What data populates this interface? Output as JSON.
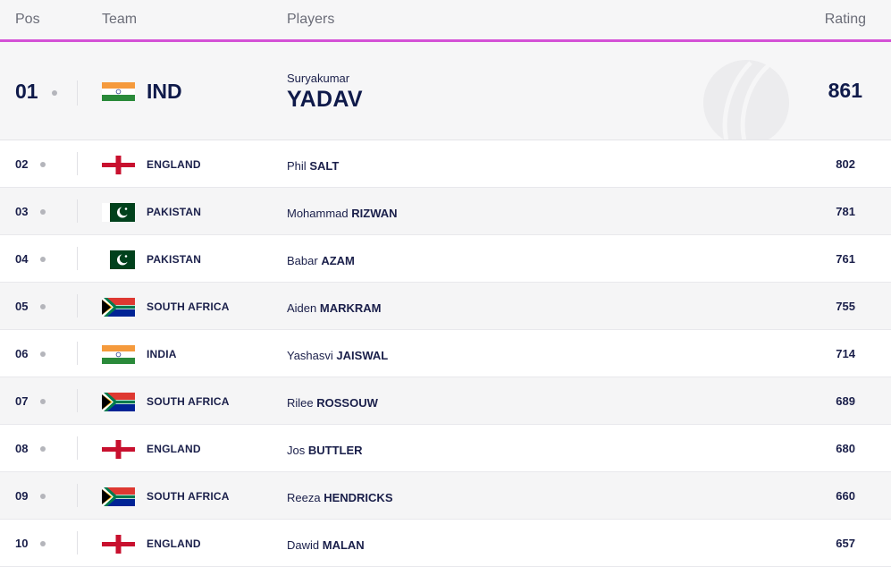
{
  "header": {
    "pos": "Pos",
    "team": "Team",
    "players": "Players",
    "rating": "Rating"
  },
  "colors": {
    "accent": "#d451d6",
    "text_dark": "#0f1a4a"
  },
  "top": {
    "pos": "01",
    "flag": "india-flag-icon",
    "team": "IND",
    "first_name": "Suryakumar",
    "last_name": "YADAV",
    "rating": "861",
    "watermark": "cricket-ball-logo-icon"
  },
  "rows": [
    {
      "pos": "02",
      "flag": "england",
      "team": "ENGLAND",
      "first": "Phil",
      "last": "SALT",
      "rating": "802"
    },
    {
      "pos": "03",
      "flag": "pakistan",
      "team": "PAKISTAN",
      "first": "Mohammad",
      "last": "RIZWAN",
      "rating": "781"
    },
    {
      "pos": "04",
      "flag": "pakistan",
      "team": "PAKISTAN",
      "first": "Babar",
      "last": "AZAM",
      "rating": "761"
    },
    {
      "pos": "05",
      "flag": "south-africa",
      "team": "SOUTH AFRICA",
      "first": "Aiden",
      "last": "MARKRAM",
      "rating": "755"
    },
    {
      "pos": "06",
      "flag": "india",
      "team": "INDIA",
      "first": "Yashasvi",
      "last": "JAISWAL",
      "rating": "714"
    },
    {
      "pos": "07",
      "flag": "south-africa",
      "team": "SOUTH AFRICA",
      "first": "Rilee",
      "last": "ROSSOUW",
      "rating": "689"
    },
    {
      "pos": "08",
      "flag": "england",
      "team": "ENGLAND",
      "first": "Jos",
      "last": "BUTTLER",
      "rating": "680"
    },
    {
      "pos": "09",
      "flag": "south-africa",
      "team": "SOUTH AFRICA",
      "first": "Reeza",
      "last": "HENDRICKS",
      "rating": "660"
    },
    {
      "pos": "10",
      "flag": "england",
      "team": "ENGLAND",
      "first": "Dawid",
      "last": "MALAN",
      "rating": "657"
    }
  ]
}
